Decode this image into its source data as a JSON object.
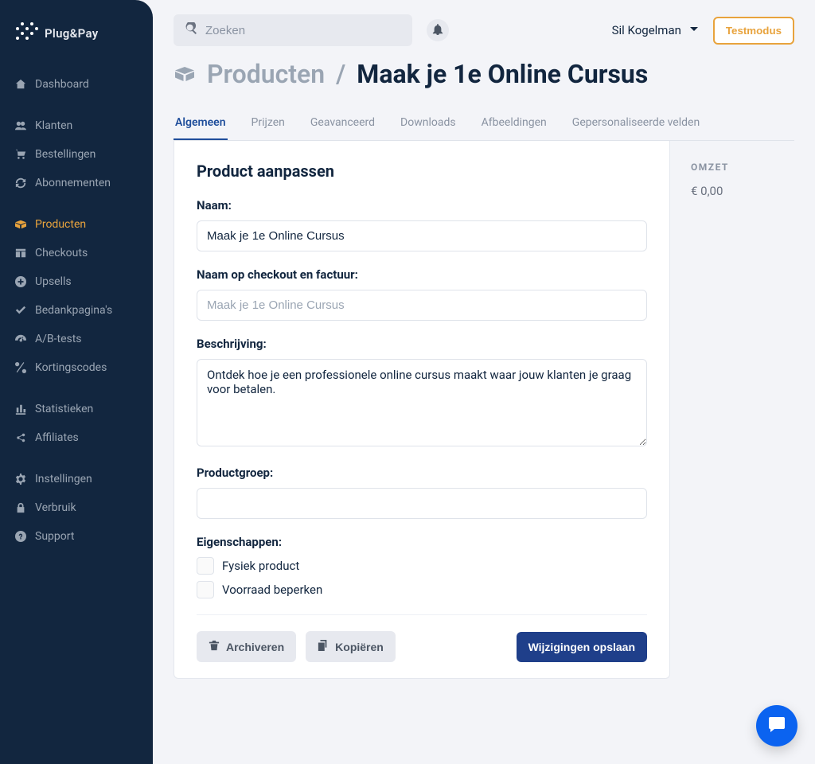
{
  "brand": {
    "name": "Plug&Pay"
  },
  "sidebar": {
    "items": [
      {
        "label": "Dashboard",
        "icon": "home-icon"
      },
      {
        "label": "Klanten",
        "icon": "users-icon"
      },
      {
        "label": "Bestellingen",
        "icon": "cart-icon"
      },
      {
        "label": "Abonnementen",
        "icon": "sync-icon"
      },
      {
        "label": "Producten",
        "icon": "box-open-icon",
        "active": true
      },
      {
        "label": "Checkouts",
        "icon": "table-icon"
      },
      {
        "label": "Upsells",
        "icon": "plus-circle-icon"
      },
      {
        "label": "Bedankpagina's",
        "icon": "check-icon"
      },
      {
        "label": "A/B-tests",
        "icon": "gauge-icon"
      },
      {
        "label": "Kortingscodes",
        "icon": "percent-icon"
      },
      {
        "label": "Statistieken",
        "icon": "bar-chart-icon"
      },
      {
        "label": "Affiliates",
        "icon": "share-icon"
      },
      {
        "label": "Instellingen",
        "icon": "gear-icon"
      },
      {
        "label": "Verbruik",
        "icon": "lock-icon"
      },
      {
        "label": "Support",
        "icon": "question-icon"
      }
    ]
  },
  "topbar": {
    "search_placeholder": "Zoeken",
    "user_name": "Sil Kogelman",
    "testmode_label": "Testmodus"
  },
  "breadcrumb": {
    "parent": "Producten",
    "current": "Maak je 1e Online Cursus"
  },
  "tabs": [
    {
      "label": "Algemeen",
      "active": true
    },
    {
      "label": "Prijzen"
    },
    {
      "label": "Geavanceerd"
    },
    {
      "label": "Downloads"
    },
    {
      "label": "Afbeeldingen"
    },
    {
      "label": "Gepersonaliseerde velden"
    }
  ],
  "panel": {
    "heading": "Product aanpassen",
    "name_label": "Naam:",
    "name_value": "Maak je 1e Online Cursus",
    "invoice_label": "Naam op checkout en factuur:",
    "invoice_placeholder": "Maak je 1e Online Cursus",
    "description_label": "Beschrijving:",
    "description_value": "Ontdek hoe je een professionele online cursus maakt waar jouw klanten je graag voor betalen.",
    "group_label": "Productgroep:",
    "group_value": "",
    "props_label": "Eigenschappen:",
    "physical_label": "Fysiek product",
    "stock_label": "Voorraad beperken",
    "archive_label": "Archiveren",
    "copy_label": "Kopiëren",
    "save_label": "Wijzigingen opslaan"
  },
  "side": {
    "heading": "OMZET",
    "amount": "€ 0,00"
  },
  "colors": {
    "accent": "#e8a33d",
    "primary": "#1f3f8a",
    "intercom": "#0b63f0"
  }
}
